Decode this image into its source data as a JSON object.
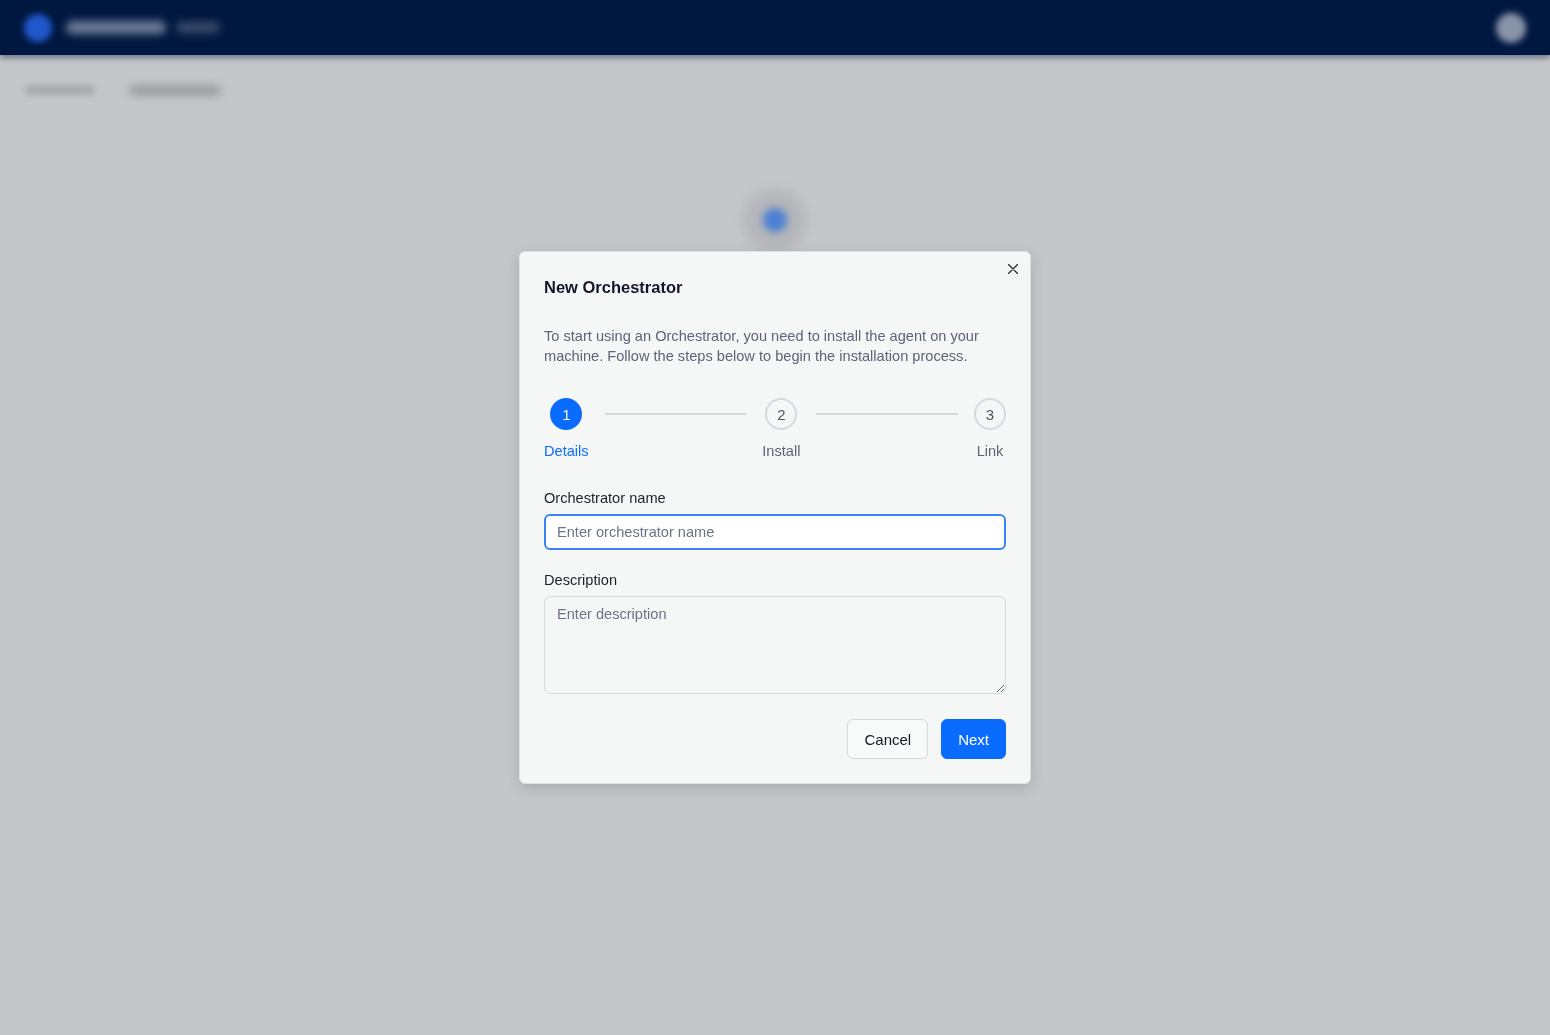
{
  "dialog": {
    "title": "New Orchestrator",
    "description": "To start using an Orchestrator, you need to install the agent on your machine. Follow the steps below to begin the installation process.",
    "steps": [
      {
        "number": "1",
        "label": "Details",
        "current": true
      },
      {
        "number": "2",
        "label": "Install",
        "current": false
      },
      {
        "number": "3",
        "label": "Link",
        "current": false
      }
    ],
    "fields": [
      {
        "kind": "input",
        "label": "Orchestrator name",
        "placeholder": "Enter orchestrator name",
        "focused": true
      },
      {
        "kind": "textarea",
        "label": "Description",
        "placeholder": "Enter description",
        "focused": false
      }
    ],
    "buttons": [
      {
        "kind": "secondary",
        "label": "Cancel"
      },
      {
        "kind": "primary",
        "label": "Next"
      }
    ]
  }
}
